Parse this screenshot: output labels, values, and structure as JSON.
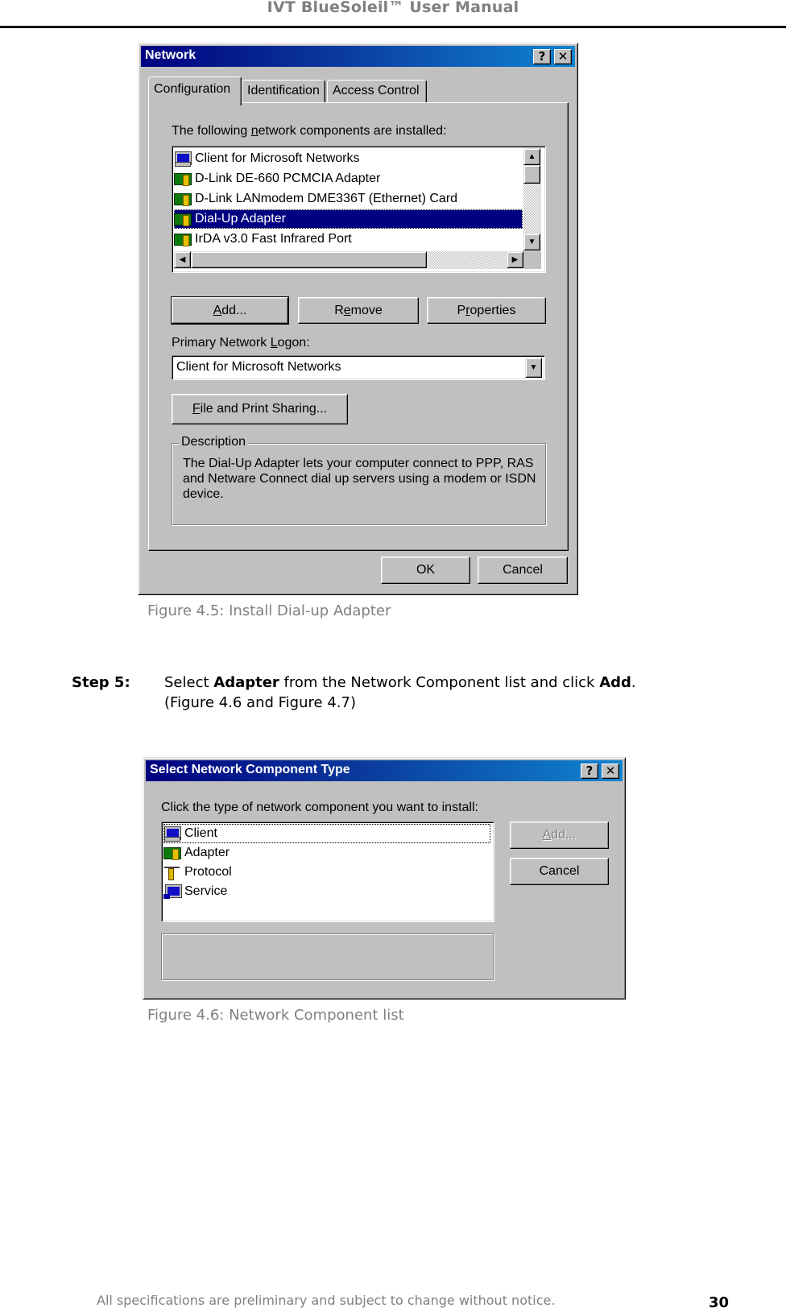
{
  "header": {
    "title": "IVT BlueSoleil™ User Manual"
  },
  "figure_4_5": {
    "window_title": "Network",
    "title_buttons": {
      "help": "?",
      "close": "✕"
    },
    "tabs": [
      {
        "label": "Configuration",
        "active": true
      },
      {
        "label": "Identification",
        "active": false
      },
      {
        "label": "Access Control",
        "active": false
      }
    ],
    "components_label": {
      "pre": "The following ",
      "mnemonic": "n",
      "post": "etwork components are installed:"
    },
    "components": [
      {
        "icon": "client-icon",
        "label": "Client for Microsoft Networks",
        "selected": false
      },
      {
        "icon": "adapter-icon",
        "label": "D-Link DE-660 PCMCIA Adapter",
        "selected": false
      },
      {
        "icon": "adapter-icon",
        "label": "D-Link LANmodem DME336T (Ethernet) Card",
        "selected": false
      },
      {
        "icon": "adapter-icon",
        "label": "Dial-Up Adapter",
        "selected": true
      },
      {
        "icon": "adapter-icon",
        "label": "IrDA v3.0 Fast Infrared Port",
        "selected": false
      }
    ],
    "buttons": {
      "add": {
        "mnemonic": "A",
        "rest": "dd..."
      },
      "remove": {
        "pre": "R",
        "mnemonic": "e",
        "rest": "move"
      },
      "properties": {
        "pre": "P",
        "mnemonic": "r",
        "rest": "operties"
      }
    },
    "logon_label": {
      "pre": "Primary Network ",
      "mnemonic": "L",
      "post": "ogon:"
    },
    "logon_value": "Client for Microsoft Networks",
    "file_print_button": {
      "mnemonic": "F",
      "rest": "ile and Print Sharing..."
    },
    "description": {
      "legend": "Description",
      "lines": [
        "The Dial-Up Adapter lets your computer connect to PPP, RAS",
        "and Netware Connect dial up servers using a modem or ISDN",
        "device."
      ]
    },
    "ok_label": "OK",
    "cancel_label": "Cancel",
    "caption": "Figure 4.5: Install Dial-up Adapter"
  },
  "step5": {
    "label": "Step 5:",
    "line1": {
      "t1": "Select ",
      "b1": "Adapter",
      "t2": " from the Network Component list and click ",
      "b2": "Add",
      "t3": "."
    },
    "line2": "(Figure 4.6 and Figure 4.7)"
  },
  "figure_4_6": {
    "window_title": "Select Network Component Type",
    "title_buttons": {
      "help": "?",
      "close": "✕"
    },
    "prompt": "Click the type of network component you want to install:",
    "items": [
      {
        "icon": "client-icon",
        "label": "Client",
        "focused": true
      },
      {
        "icon": "adapter-icon",
        "label": "Adapter",
        "focused": false
      },
      {
        "icon": "protocol-icon",
        "label": "Protocol",
        "focused": false
      },
      {
        "icon": "service-icon",
        "label": "Service",
        "focused": false
      }
    ],
    "add_button": {
      "mnemonic": "A",
      "rest": "dd...",
      "disabled": true
    },
    "cancel_label": "Cancel",
    "caption": "Figure 4.6: Network Component list"
  },
  "footer": {
    "notice": "All specifications are preliminary and subject to change without notice.",
    "page_number": "30"
  }
}
